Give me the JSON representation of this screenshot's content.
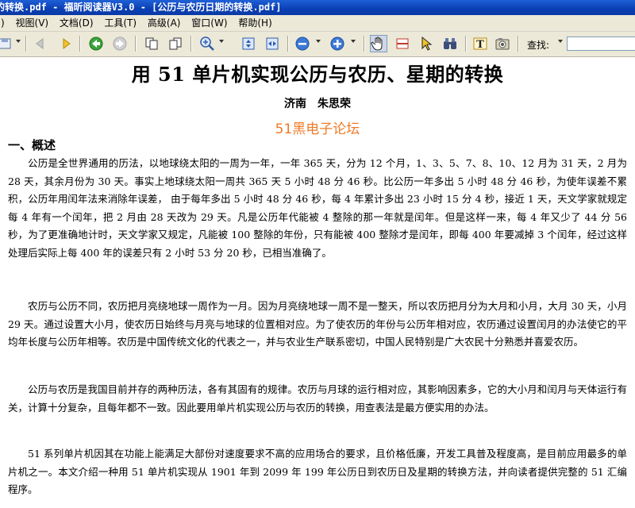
{
  "window": {
    "title": "的转换.pdf - 福昕阅读器V3.0 - [公历与农历日期的转换.pdf]"
  },
  "menu": {
    "items": [
      {
        "label": ")"
      },
      {
        "label": "视图(V)"
      },
      {
        "label": "文档(D)"
      },
      {
        "label": "工具(T)"
      },
      {
        "label": "高级(A)"
      },
      {
        "label": "窗口(W)"
      },
      {
        "label": "帮助(H)"
      }
    ]
  },
  "toolbar": {
    "find_label": "查找:",
    "find_value": "",
    "icons": [
      "save-icon",
      "first-page-icon",
      "last-page-icon",
      "back-icon",
      "forward-icon",
      "prev-view-icon",
      "next-view-icon",
      "zoom-in-icon",
      "fit-page-icon",
      "fit-width-icon",
      "zoom-out-icon",
      "zoom-plus-icon",
      "hand-tool-icon",
      "snapshot-icon",
      "select-arrow-icon",
      "binoculars-icon",
      "text-select-icon",
      "camera-icon"
    ]
  },
  "document": {
    "title": "用 51 单片机实现公历与农历、星期的转换",
    "author": "济南　朱思荣",
    "watermark": "51黑电子论坛",
    "section_heading": "一、概述",
    "paragraphs": [
      "公历是全世界通用的历法，以地球绕太阳的一周为一年，一年 365 天，分为 12 个月，1、3、5、7、8、10、12 月为 31 天，2 月为 28 天，其余月份为 30 天。事实上地球绕太阳一周共 365 天 5 小时 48 分 46 秒。比公历一年多出 5 小时 48 分 46 秒，为使年误差不累积，公历年用闰年法来消除年误差， 由于每年多出 5 小时 48 分 46 秒，每 4 年累计多出 23 小时 15 分 4 秒，接近 1 天，天文学家就规定每 4 年有一个闰年，把 2 月由 28 天改为 29 天。凡是公历年代能被 4 整除的那一年就是闰年。但是这样一来，每 4 年又少了 44 分 56 秒，为了更准确地计时，天文学家又规定，凡能被 100 整除的年份，只有能被 400 整除才是闰年，即每 400 年要减掉 3 个闰年，经过这样处理后实际上每 400 年的误差只有 2 小时 53 分 20 秒，已相当准确了。",
      "农历与公历不同，农历把月亮绕地球一周作为一月。因为月亮绕地球一周不是一整天，所以农历把月分为大月和小月，大月 30 天，小月 29 天。通过设置大小月，使农历日始终与月亮与地球的位置相对应。为了使农历的年份与公历年相对应，农历通过设置闰月的办法使它的平均年长度与公历年相等。农历是中国传统文化的代表之一，并与农业生产联系密切，中国人民特别是广大农民十分熟悉并喜爱农历。",
      "公历与农历是我国目前并存的两种历法，各有其固有的规律。农历与月球的运行相对应，其影响因素多，它的大小月和闰月与天体运行有关，计算十分复杂，且每年都不一致。因此要用单片机实现公历与农历的转换，用查表法是最方便实用的办法。",
      "51 系列单片机因其在功能上能满足大部份对速度要求不高的应用场合的要求，且价格低廉，开发工具普及程度高，是目前应用最多的单片机之一。本文介绍一种用 51 单片机实现从 1901 年到 2099 年 199 年公历日到农历日及星期的转换方法，并向读者提供完整的 51 汇编程序。"
    ]
  }
}
